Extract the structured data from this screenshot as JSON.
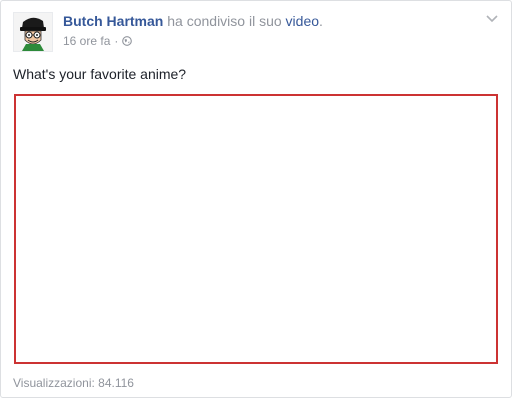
{
  "post": {
    "author": "Butch Hartman",
    "action_text": " ha condiviso il suo ",
    "object_link": "video",
    "object_suffix": ".",
    "timestamp": "16 ore fa",
    "separator": "·",
    "audience_icon": "globe-icon",
    "menu_icon": "chevron-down-icon",
    "message": "What's your favorite anime?",
    "views": "Visualizzazioni: 84.116"
  },
  "colors": {
    "link": "#365899",
    "meta_text": "#90949c",
    "body_text": "#1d2129",
    "video_border": "#cc3333"
  }
}
